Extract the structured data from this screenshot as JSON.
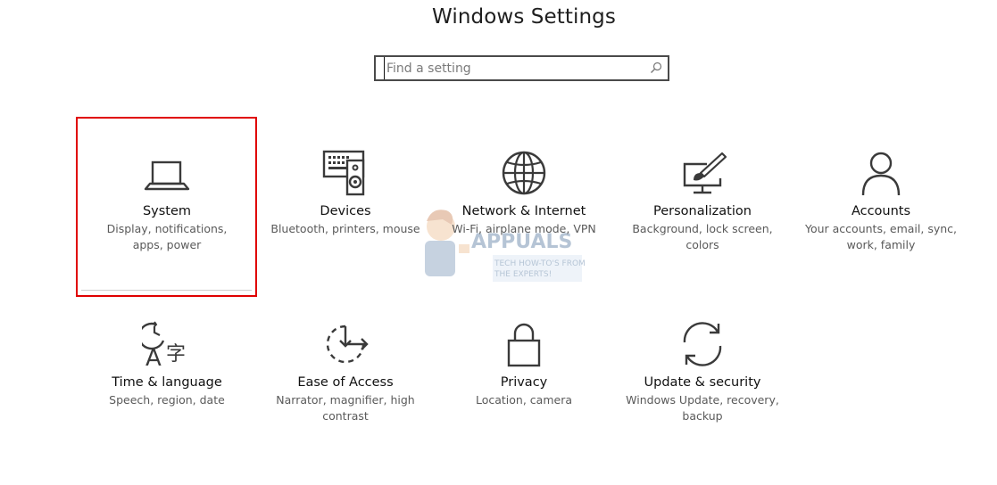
{
  "window": {
    "title": "Windows Settings"
  },
  "search": {
    "placeholder": "Find a setting",
    "icon": "search-icon"
  },
  "tiles": [
    {
      "id": "system",
      "label": "System",
      "description": "Display, notifications, apps, power",
      "icon": "laptop-icon",
      "selected": true
    },
    {
      "id": "devices",
      "label": "Devices",
      "description": "Bluetooth, printers, mouse",
      "icon": "keyboard-speaker-icon",
      "selected": false
    },
    {
      "id": "network",
      "label": "Network & Internet",
      "description": "Wi-Fi, airplane mode, VPN",
      "icon": "globe-icon",
      "selected": false
    },
    {
      "id": "personalization",
      "label": "Personalization",
      "description": "Background, lock screen, colors",
      "icon": "paintbrush-monitor-icon",
      "selected": false
    },
    {
      "id": "accounts",
      "label": "Accounts",
      "description": "Your accounts, email, sync, work, family",
      "icon": "person-icon",
      "selected": false
    },
    {
      "id": "time-language",
      "label": "Time & language",
      "description": "Speech, region, date",
      "icon": "clock-language-icon",
      "selected": false
    },
    {
      "id": "ease-of-access",
      "label": "Ease of Access",
      "description": "Narrator, magnifier, high contrast",
      "icon": "ease-of-access-icon",
      "selected": false
    },
    {
      "id": "privacy",
      "label": "Privacy",
      "description": "Location, camera",
      "icon": "lock-icon",
      "selected": false
    },
    {
      "id": "update-security",
      "label": "Update & security",
      "description": "Windows Update, recovery, backup",
      "icon": "sync-arrows-icon",
      "selected": false
    }
  ],
  "watermark": {
    "brand": "APPUALS",
    "tagline_1": "TECH HOW-TO'S FROM",
    "tagline_2": "THE EXPERTS!"
  },
  "colors": {
    "selection_border": "#e00000",
    "icon_stroke": "#3a3a3a",
    "description_text": "#5a5a5a"
  }
}
